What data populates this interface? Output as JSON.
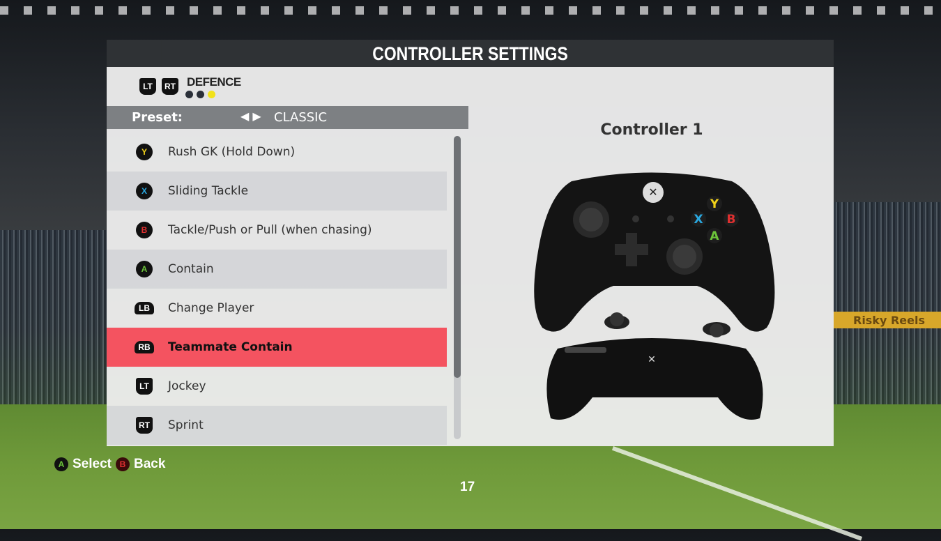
{
  "title": "CONTROLLER SETTINGS",
  "mode": {
    "name": "DEFENCE",
    "left_trigger": "LT",
    "right_trigger": "RT",
    "page_dots": 3,
    "active_dot": 3,
    "active_color": "#f2e21a"
  },
  "preset": {
    "label": "Preset:",
    "value": "CLASSIC"
  },
  "actions": [
    {
      "button": "Y",
      "color": "#f2d21a",
      "type": "face",
      "label": "Rush GK (Hold Down)"
    },
    {
      "button": "X",
      "color": "#2aa8e0",
      "type": "face",
      "label": "Sliding Tackle"
    },
    {
      "button": "B",
      "color": "#e03030",
      "type": "face",
      "label": "Tackle/Push or Pull (when chasing)"
    },
    {
      "button": "A",
      "color": "#6cc43a",
      "type": "face",
      "label": "Contain"
    },
    {
      "button": "LB",
      "color": "#ffffff",
      "type": "bumper",
      "label": "Change Player"
    },
    {
      "button": "RB",
      "color": "#ffffff",
      "type": "bumper",
      "label": "Teammate Contain",
      "selected": true
    },
    {
      "button": "LT",
      "color": "#ffffff",
      "type": "trigger",
      "label": "Jockey"
    },
    {
      "button": "RT",
      "color": "#ffffff",
      "type": "trigger",
      "label": "Sprint"
    }
  ],
  "scroll_position_percent": 0,
  "controller": {
    "title": "Controller 1",
    "face_labels": [
      "Y",
      "X",
      "B",
      "A"
    ]
  },
  "footer": {
    "select": {
      "button": "A",
      "label": "Select"
    },
    "back": {
      "button": "B",
      "label": "Back"
    },
    "page": "17"
  },
  "background": {
    "banner": "Risky Reels"
  },
  "colors": {
    "selected_row": "#f45360",
    "title_bar": "#2f3235",
    "preset_bar": "#7d8083"
  }
}
